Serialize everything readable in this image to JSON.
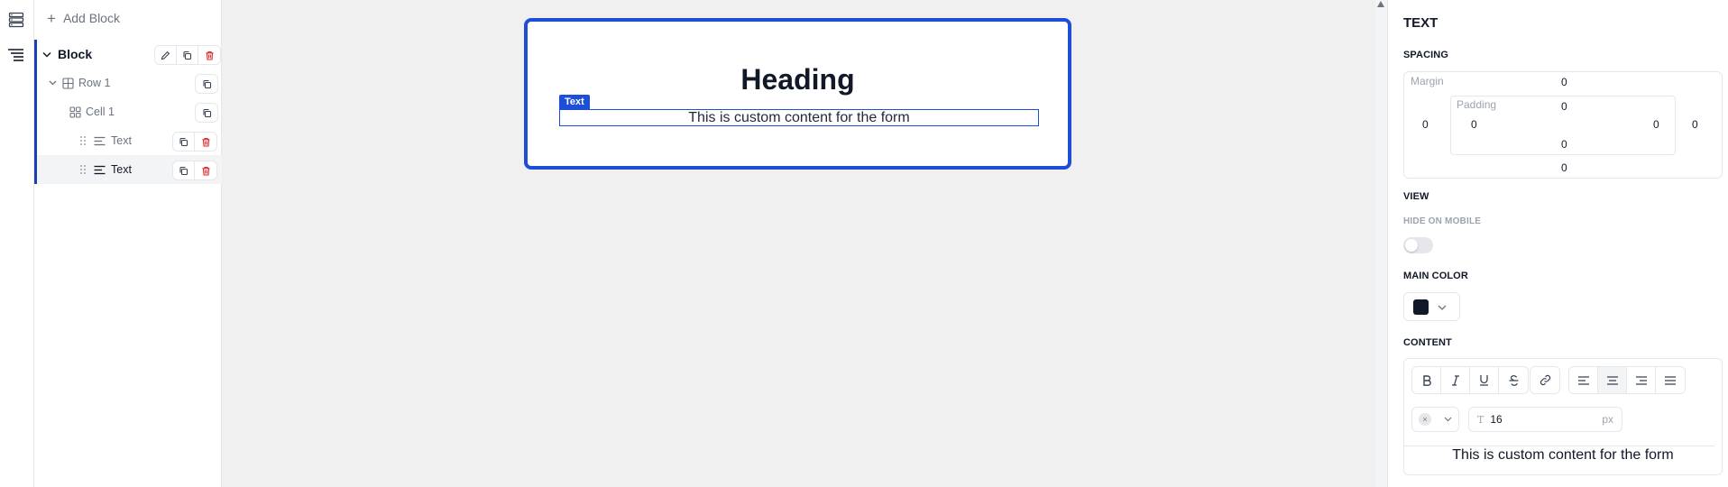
{
  "sidebar": {
    "add_block_label": "Add Block",
    "tree": {
      "block_label": "Block",
      "row_label": "Row 1",
      "cell_label": "Cell 1",
      "text1_label": "Text",
      "text2_label": "Text"
    }
  },
  "canvas": {
    "heading": "Heading",
    "selection_tag": "Text",
    "selected_text": "This is custom content for the form"
  },
  "props": {
    "title": "TEXT",
    "spacing": {
      "section_label": "SPACING",
      "margin_label": "Margin",
      "padding_label": "Padding",
      "margin_top": "0",
      "margin_right": "0",
      "margin_bottom": "0",
      "margin_left": "0",
      "padding_top": "0",
      "padding_right": "0",
      "padding_bottom": "0",
      "padding_left": "0"
    },
    "view": {
      "section_label": "VIEW",
      "hide_on_mobile_label": "HIDE ON MOBILE",
      "hide_on_mobile": false
    },
    "main_color": {
      "section_label": "MAIN COLOR",
      "value": "#111827"
    },
    "content": {
      "section_label": "CONTENT",
      "font_size": "16",
      "font_size_unit": "px",
      "clear_symbol": "×",
      "preview_text": "This is custom content for the form",
      "alignment": "center"
    }
  },
  "colors": {
    "accent": "#1d4ed8",
    "delete": "#dc2626",
    "canvas_bg": "#f0f0f0"
  },
  "icons": [
    "layers-icon",
    "list-tree-icon",
    "plus-icon",
    "chevron-down-icon",
    "pencil-icon",
    "copy-icon",
    "trash-icon",
    "grid-icon",
    "drag-handle-icon",
    "text-lines-icon",
    "bold-icon",
    "italic-icon",
    "underline-icon",
    "strikethrough-icon",
    "link-icon",
    "align-left-icon",
    "align-center-icon",
    "align-right-icon",
    "align-justify-icon",
    "font-size-icon"
  ]
}
